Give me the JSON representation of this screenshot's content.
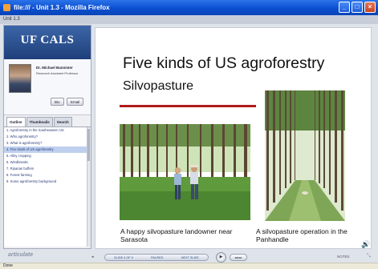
{
  "window": {
    "title": "file:/// - Unit 1.3 - Mozilla Firefox",
    "minimize": "_",
    "maximize": "□",
    "close": "×"
  },
  "unit_bar": {
    "label": "Unit 1.3"
  },
  "sidebar": {
    "brand": "UF CALS",
    "presenter": {
      "name": "Dr. Michael Bannister",
      "title": "Research Assistant Professor"
    },
    "bio_button": "Bio",
    "email_button": "Email",
    "tabs": [
      {
        "label": "Outline",
        "active": true
      },
      {
        "label": "Thumbnails",
        "active": false
      },
      {
        "label": "Search",
        "active": false
      }
    ],
    "outline_items": [
      {
        "label": "1. Agroforestry in the Southeastern US",
        "current": false
      },
      {
        "label": "2. Who agroforestry?",
        "current": false
      },
      {
        "label": "3. What is agroforestry?",
        "current": false
      },
      {
        "label": "4. Five kinds of US agroforestry",
        "current": true
      },
      {
        "label": "5. Alley cropping",
        "current": false
      },
      {
        "label": "6. Windbreaks",
        "current": false
      },
      {
        "label": "7. Riparian buffers",
        "current": false
      },
      {
        "label": "8. Forest farming",
        "current": false
      },
      {
        "label": "9. Some agroforestry background",
        "current": false
      }
    ]
  },
  "slide": {
    "title": "Five kinds of US agroforestry",
    "subtitle": "Silvopasture",
    "caption_left": "A happy silvopasture landowner near Sarasota",
    "caption_right": "A silvopasture operation in the Panhandle",
    "sound_icon": "🔊",
    "accent_color": "#b01a1a"
  },
  "controls": {
    "logo": "articulate",
    "prev_label": "◂",
    "slide_counter": "SLIDE 4 OF 9",
    "status": "PAUSED",
    "next_label": "NEXT SLIDE",
    "play_symbol": "▶",
    "seek_label": "◂◂  ▸▸",
    "notes_label": "NOTES",
    "resize_symbol": "⤡"
  },
  "statusbar": {
    "text": "Done"
  }
}
